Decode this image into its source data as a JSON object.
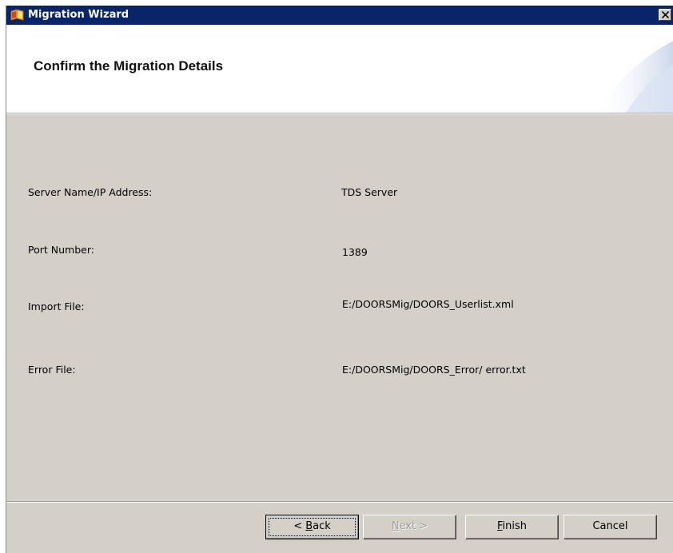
{
  "window": {
    "title": "Migration Wizard",
    "icon": "migration-wizard-icon",
    "close_icon": "close-icon"
  },
  "header": {
    "title": "Confirm the Migration Details"
  },
  "details": [
    {
      "label": "Server Name/IP Address:",
      "value": "TDS Server"
    },
    {
      "label": "Port Number:",
      "value": "1389"
    },
    {
      "label": "Import File:",
      "value": "E:/DOORSMig/DOORS_Userlist.xml"
    },
    {
      "label": "Error File:",
      "value": "E:/DOORSMig/DOORS_Error/ error.txt"
    }
  ],
  "buttons": {
    "back": {
      "label": "< Back",
      "mnemonic": "B",
      "enabled": true,
      "focused": true
    },
    "next": {
      "label": "Next >",
      "mnemonic": "N",
      "enabled": false
    },
    "finish": {
      "label": "Finish",
      "mnemonic": "F",
      "enabled": true
    },
    "cancel": {
      "label": "Cancel",
      "enabled": true
    }
  },
  "colors": {
    "titlebar": "#0a246a",
    "dialog_bg": "#d4d0c8",
    "header_bg": "#ffffff"
  }
}
